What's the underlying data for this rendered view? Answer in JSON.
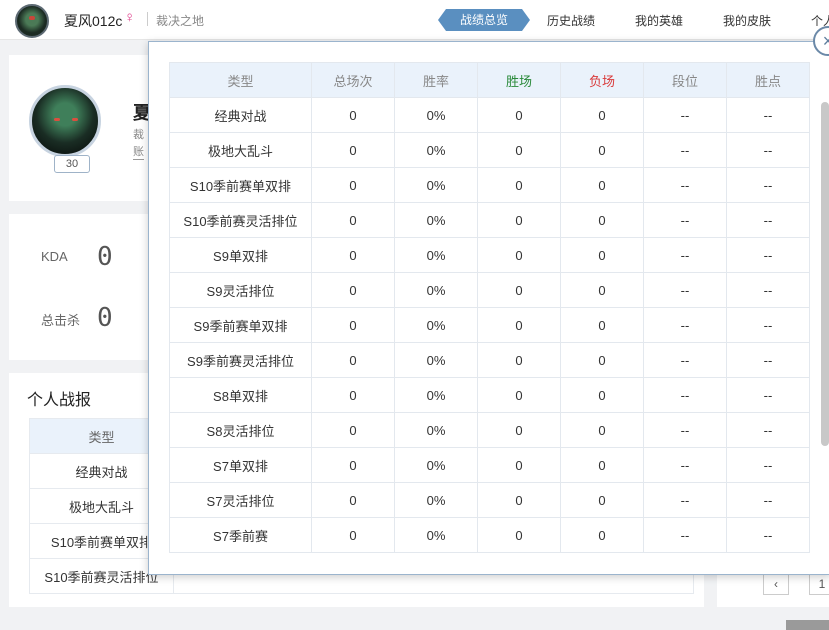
{
  "header": {
    "username": "夏风012c",
    "gender_symbol": "♀",
    "server": "裁决之地",
    "tabs": [
      {
        "label": "战绩总览",
        "active": true
      },
      {
        "label": "历史战绩",
        "active": false
      },
      {
        "label": "我的英雄",
        "active": false
      },
      {
        "label": "我的皮肤",
        "active": false
      },
      {
        "label": "个人",
        "active": false
      }
    ]
  },
  "profile": {
    "level": "30",
    "name_partial": "夏",
    "line1_partial": "裁",
    "line2_partial": "账"
  },
  "stats": {
    "kda_label": "KDA",
    "kda_value": "0",
    "kills_label": "总击杀",
    "kills_value": "0"
  },
  "personal": {
    "title": "个人战报",
    "header_type": "类型",
    "rows": [
      "经典对战",
      "极地大乱斗",
      "S10季前赛单双排",
      "S10季前赛灵活排位"
    ]
  },
  "pager": {
    "prev": "‹",
    "page": "1"
  },
  "overview": {
    "close_icon": "close-icon",
    "columns": [
      "类型",
      "总场次",
      "胜率",
      "胜场",
      "负场",
      "段位",
      "胜点"
    ],
    "column_colors": {
      "win": "#2a8a3a",
      "lose": "#d93b3b"
    },
    "rows": [
      [
        "经典对战",
        "0",
        "0%",
        "0",
        "0",
        "--",
        "--"
      ],
      [
        "极地大乱斗",
        "0",
        "0%",
        "0",
        "0",
        "--",
        "--"
      ],
      [
        "S10季前赛单双排",
        "0",
        "0%",
        "0",
        "0",
        "--",
        "--"
      ],
      [
        "S10季前赛灵活排位",
        "0",
        "0%",
        "0",
        "0",
        "--",
        "--"
      ],
      [
        "S9单双排",
        "0",
        "0%",
        "0",
        "0",
        "--",
        "--"
      ],
      [
        "S9灵活排位",
        "0",
        "0%",
        "0",
        "0",
        "--",
        "--"
      ],
      [
        "S9季前赛单双排",
        "0",
        "0%",
        "0",
        "0",
        "--",
        "--"
      ],
      [
        "S9季前赛灵活排位",
        "0",
        "0%",
        "0",
        "0",
        "--",
        "--"
      ],
      [
        "S8单双排",
        "0",
        "0%",
        "0",
        "0",
        "--",
        "--"
      ],
      [
        "S8灵活排位",
        "0",
        "0%",
        "0",
        "0",
        "--",
        "--"
      ],
      [
        "S7单双排",
        "0",
        "0%",
        "0",
        "0",
        "--",
        "--"
      ],
      [
        "S7灵活排位",
        "0",
        "0%",
        "0",
        "0",
        "--",
        "--"
      ],
      [
        "S7季前赛",
        "0",
        "0%",
        "0",
        "0",
        "--",
        "--"
      ]
    ]
  }
}
